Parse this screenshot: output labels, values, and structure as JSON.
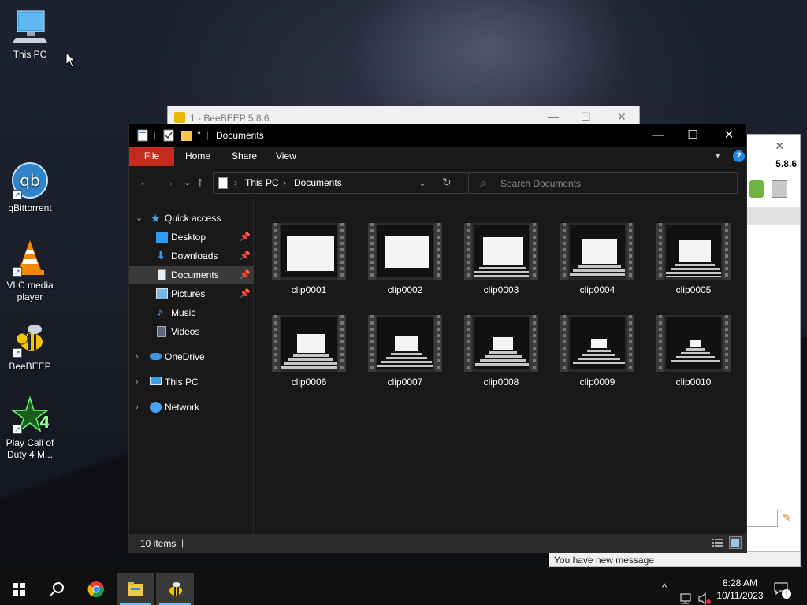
{
  "desktop": {
    "icons": [
      {
        "label": "This PC"
      },
      {
        "label": "qBittorrent"
      },
      {
        "label": "VLC media player"
      },
      {
        "label": "BeeBEEP"
      },
      {
        "label": "Play Call of Duty 4 M..."
      }
    ]
  },
  "beebeep": {
    "title": "1 - BeeBEEP 5.8.6",
    "version": "5.8.6",
    "notification": "You have new message"
  },
  "explorer": {
    "title": "Documents",
    "ribbon_tabs": [
      "File",
      "Home",
      "Share",
      "View"
    ],
    "address": [
      "This PC",
      "Documents"
    ],
    "search_placeholder": "Search Documents",
    "nav": {
      "quick_access": "Quick access",
      "items": [
        "Desktop",
        "Downloads",
        "Documents",
        "Pictures",
        "Music",
        "Videos"
      ],
      "onedrive": "OneDrive",
      "this_pc": "This PC",
      "network": "Network"
    },
    "files": [
      "clip0001",
      "clip0002",
      "clip0003",
      "clip0004",
      "clip0005",
      "clip0006",
      "clip0007",
      "clip0008",
      "clip0009",
      "clip0010"
    ],
    "status": "10 items"
  },
  "taskbar": {
    "time": "8:28 AM",
    "date": "10/11/2023",
    "notification_count": "1"
  },
  "colors": {
    "file_tab": "#c42b1c",
    "accent": "#76b9ed",
    "explorer_bg": "#191919"
  }
}
